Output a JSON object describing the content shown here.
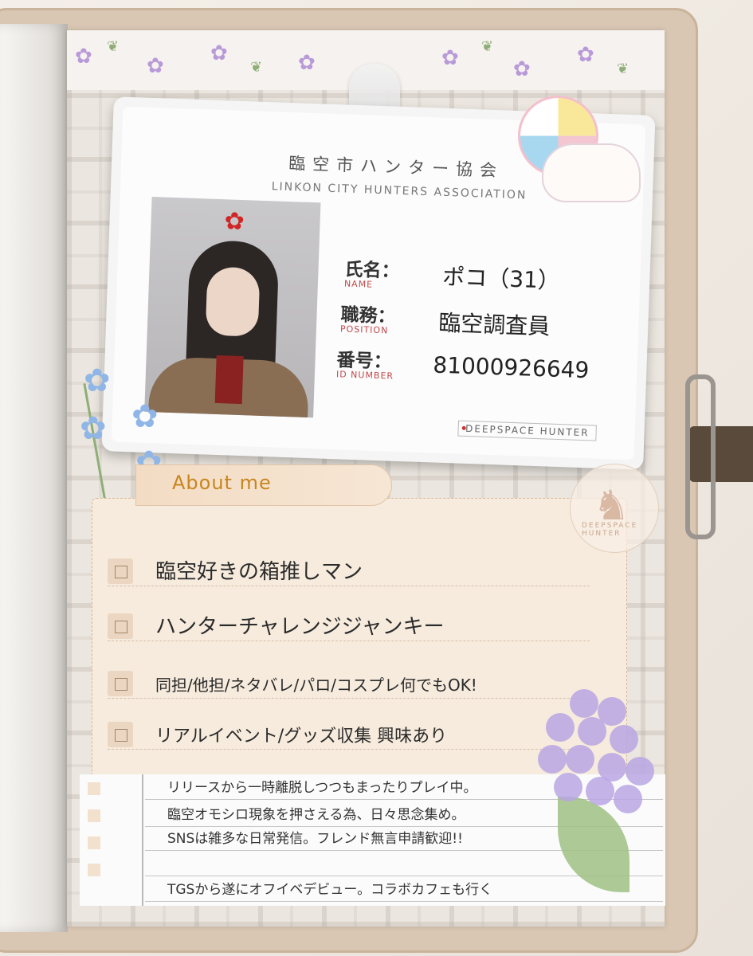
{
  "id_card": {
    "title_ja": "臨空市ハンター協会",
    "title_en": "LINKON CITY HUNTERS ASSOCIATION",
    "fields": [
      {
        "label": "氏名：",
        "label_en": "NAME",
        "value": "ポコ（31）"
      },
      {
        "label": "職務：",
        "label_en": "POSITION",
        "value": "臨空調査員"
      },
      {
        "label": "番号：",
        "label_en": "ID NUMBER",
        "value": "81000926649"
      }
    ],
    "footer": "DEEPSPACE HUNTER"
  },
  "about": {
    "heading": "About me",
    "seal_text": "DEEPSPACE HUNTER",
    "items": [
      "臨空好きの箱推しマン",
      "ハンターチャレンジジャンキー",
      "同担/他担/ネタバレ/パロ/コスプレ何でもOK!",
      "リアルイベント/グッズ収集 興味あり"
    ]
  },
  "notes": [
    "リリースから一時離脱しつつもまったりプレイ中。",
    "臨空オモシロ現象を押さえる為、日々思念集め。",
    "SNSは雑多な日常発信。フレンド無言申請歓迎!!",
    "",
    "TGSから遂にオフイベデビュー。コラボカフェも行く"
  ],
  "colors": {
    "about_accent": "#c7861f",
    "card_label_accent": "#c04a4a",
    "plaid_background": "#ebe6df"
  }
}
